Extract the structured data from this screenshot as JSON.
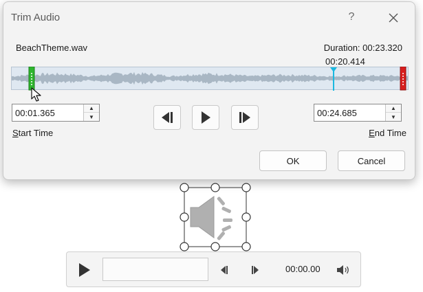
{
  "dialog": {
    "title": "Trim Audio",
    "help_label": "?",
    "filename": "BeachTheme.wav",
    "duration": "Duration: 00:23.320",
    "playhead_time": "00:20.414",
    "start_time": {
      "value": "00:01.365",
      "label_accel": "S",
      "label_rest": "tart Time"
    },
    "end_time": {
      "value": "00:24.685",
      "label_accel": "E",
      "label_rest": "nd Time"
    },
    "ok_label": "OK",
    "cancel_label": "Cancel"
  },
  "player": {
    "time": "00:00.00"
  },
  "colors": {
    "start_marker": "#2eb52e",
    "end_marker": "#d81e1e",
    "playhead": "#1ab8e0",
    "waveform_bg": "#dfe8f1",
    "waveform_wave": "#a9b7c4"
  },
  "icons": {
    "close": "close-icon",
    "prev_frame": "previous-frame-icon",
    "play": "play-icon",
    "next_frame": "next-frame-icon",
    "speaker": "speaker-icon",
    "volume": "volume-icon",
    "cursor": "mouse-pointer-icon"
  }
}
